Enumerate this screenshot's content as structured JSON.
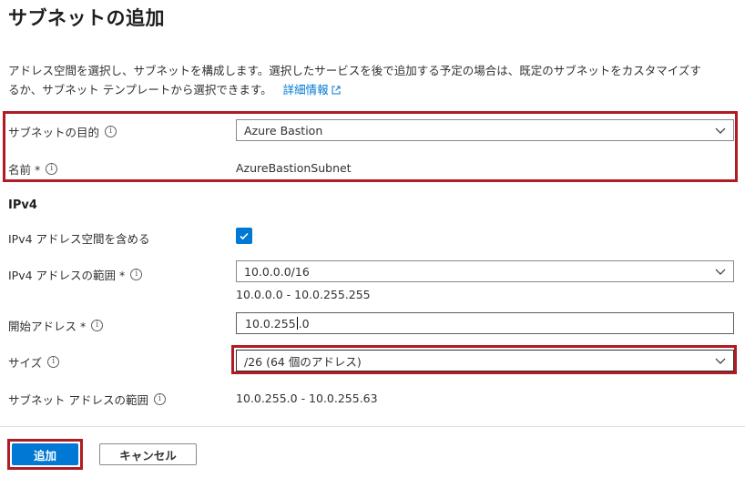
{
  "page": {
    "title": "サブネットの追加",
    "description_line1": "アドレス空間を選択し、サブネットを構成します。選択したサービスを後で追加する予定の場合は、既定のサブネットをカスタマイズす",
    "description_line2": "るか、サブネット テンプレートから選択できます。",
    "learn_more": "詳細情報"
  },
  "subnet_purpose": {
    "label": "サブネットの目的",
    "value": "Azure Bastion"
  },
  "name": {
    "label": "名前 *",
    "value": "AzureBastionSubnet"
  },
  "ipv4": {
    "section_title": "IPv4",
    "include_label": "IPv4 アドレス空間を含める",
    "include_checked": true,
    "range_label": "IPv4 アドレスの範囲 *",
    "range_value": "10.0.0.0/16",
    "range_hint": "10.0.0.0 - 10.0.255.255",
    "start_label": "開始アドレス *",
    "start_value_before_caret": "10.0.255",
    "start_value_after_caret": ".0",
    "size_label": "サイズ",
    "size_value": "/26 (64 個のアドレス)",
    "subnet_range_label": "サブネット アドレスの範囲",
    "subnet_range_value": "10.0.255.0 - 10.0.255.63"
  },
  "buttons": {
    "add": "追加",
    "cancel": "キャンセル"
  },
  "colors": {
    "accent": "#0078d4",
    "highlight": "#b11c22"
  }
}
